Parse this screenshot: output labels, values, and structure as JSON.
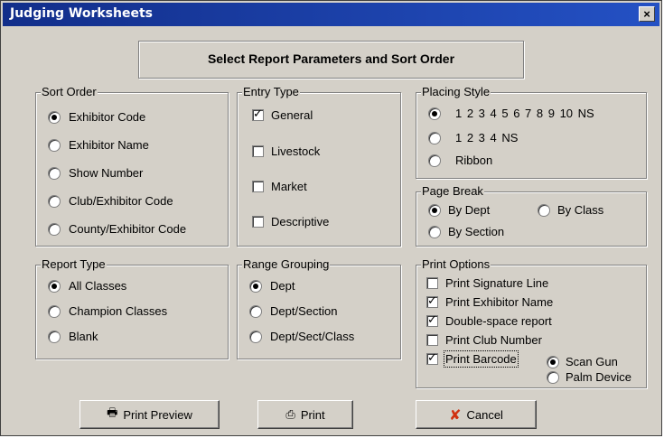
{
  "window": {
    "title": "Judging Worksheets",
    "close_glyph": "×"
  },
  "header": {
    "banner": "Select Report Parameters and Sort Order"
  },
  "sort_order": {
    "legend": "Sort Order",
    "options": [
      "Exhibitor Code",
      "Exhibitor Name",
      "Show Number",
      "Club/Exhibitor Code",
      "County/Exhibitor Code"
    ],
    "selected": "Exhibitor Code"
  },
  "entry_type": {
    "legend": "Entry Type",
    "options": [
      {
        "label": "General",
        "checked": true
      },
      {
        "label": "Livestock",
        "checked": false
      },
      {
        "label": "Market",
        "checked": false
      },
      {
        "label": "Descriptive",
        "checked": false
      }
    ]
  },
  "placing_style": {
    "legend": "Placing Style",
    "options": [
      "1 2 3 4 5 6 7 8 9 10 NS",
      "1 2 3 4 NS",
      "Ribbon"
    ],
    "selected": "1 2 3 4 5 6 7 8 9 10 NS"
  },
  "page_break": {
    "legend": "Page Break",
    "options": [
      "By Dept",
      "By Class",
      "By Section"
    ],
    "selected": "By Dept"
  },
  "report_type": {
    "legend": "Report Type",
    "options": [
      "All Classes",
      "Champion Classes",
      "Blank"
    ],
    "selected": "All Classes"
  },
  "range_grouping": {
    "legend": "Range Grouping",
    "options": [
      "Dept",
      "Dept/Section",
      "Dept/Sect/Class"
    ],
    "selected": "Dept"
  },
  "print_options": {
    "legend": "Print Options",
    "options": [
      {
        "label": "Print Signature Line",
        "checked": false
      },
      {
        "label": "Print Exhibitor Name",
        "checked": true
      },
      {
        "label": "Double-space report",
        "checked": true
      },
      {
        "label": "Print Club Number",
        "checked": false
      },
      {
        "label": "Print Barcode",
        "checked": true
      }
    ],
    "barcode_devices": [
      "Scan Gun",
      "Palm Device"
    ],
    "barcode_selected": "Scan Gun"
  },
  "buttons": {
    "print_preview": {
      "label": "Print Preview",
      "icon": "print-preview-icon"
    },
    "print": {
      "label": "Print",
      "icon": "printer-icon"
    },
    "cancel": {
      "label": "Cancel",
      "icon": "cancel-x-icon",
      "icon_color": "#d03010"
    }
  }
}
